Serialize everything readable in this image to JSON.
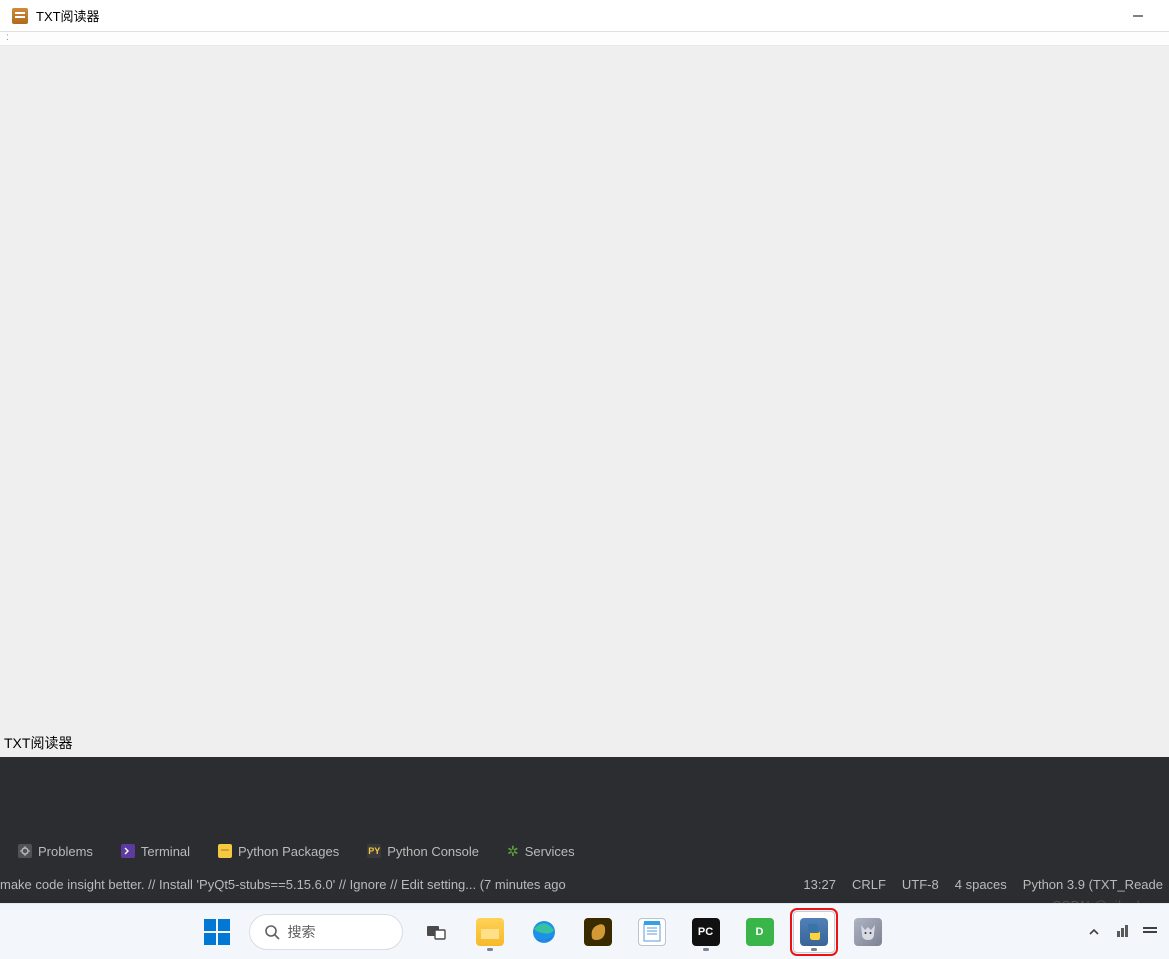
{
  "app": {
    "title": "TXT阅读器",
    "menubar_hint": ":",
    "status_text": "TXT阅读器"
  },
  "ide": {
    "tabs": {
      "problems": "Problems",
      "terminal": "Terminal",
      "packages": "Python Packages",
      "console": "Python Console",
      "services": "Services",
      "py_badge": "PY"
    },
    "status": {
      "message": "make code insight better. // Install 'PyQt5-stubs==5.15.6.0' // Ignore // Edit setting... (7 minutes ago",
      "col": "13:27",
      "line_sep": "CRLF",
      "encoding": "UTF-8",
      "indent": "4 spaces",
      "interpreter": "Python 3.9 (TXT_Reade"
    }
  },
  "taskbar": {
    "search_placeholder": "搜索",
    "apps": {
      "pycharm_badge": "PC",
      "d_badge": "D"
    }
  },
  "watermark": "CSDN @pikeduo"
}
